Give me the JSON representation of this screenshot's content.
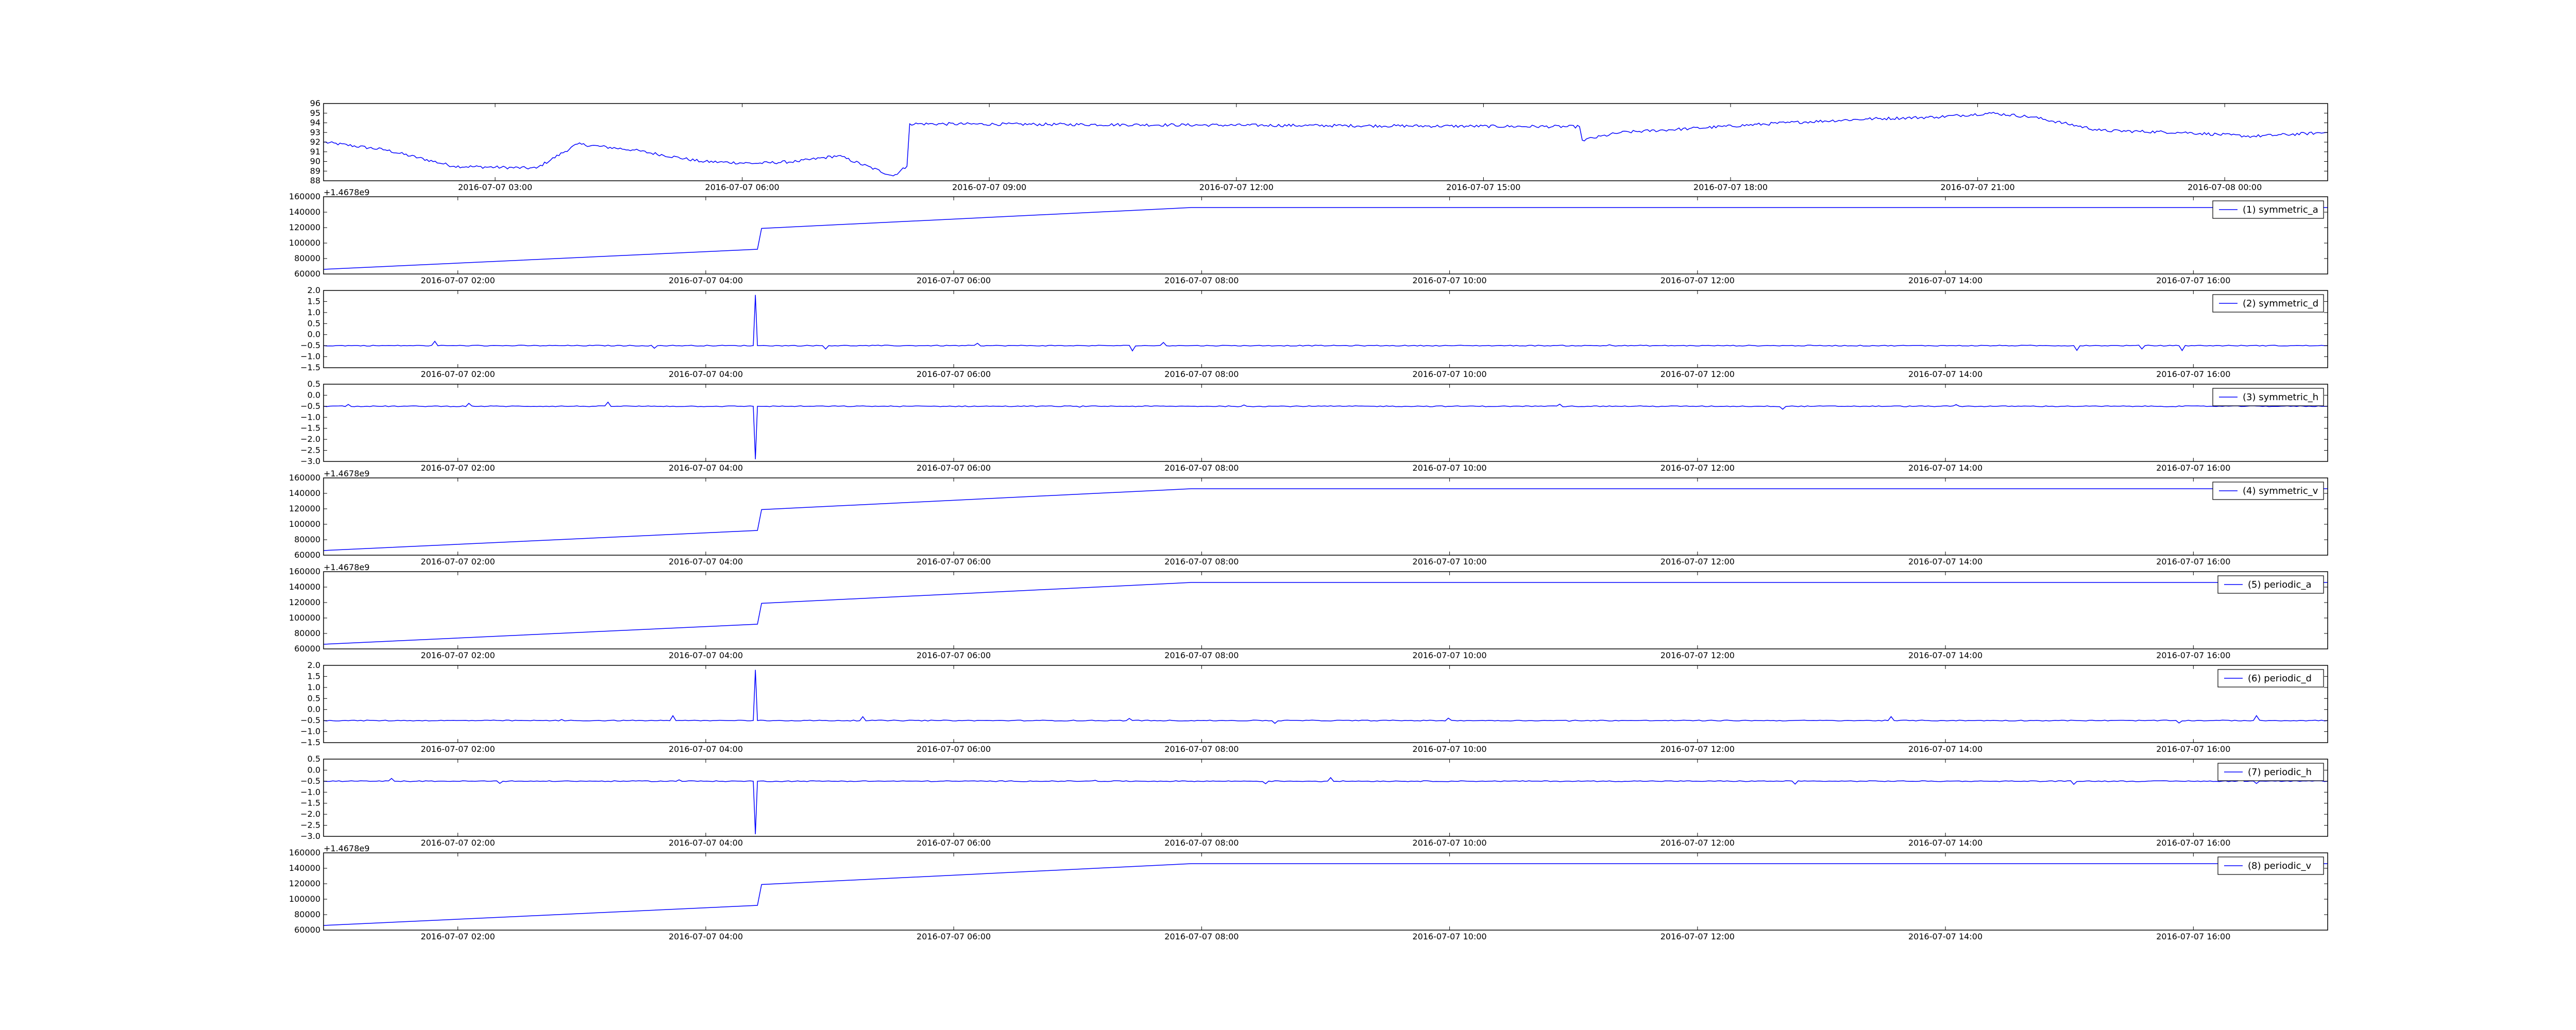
{
  "figure": {
    "background": "#ffffff",
    "line_color": "#0000ff"
  },
  "chart_data": [
    {
      "type": "line",
      "panel": 0,
      "ylim": [
        88,
        96
      ],
      "yticks": [
        88,
        89,
        90,
        91,
        92,
        93,
        94,
        95,
        96
      ],
      "ytick_labels": [
        "88",
        "89",
        "90",
        "91",
        "92",
        "93",
        "94",
        "95",
        "96"
      ],
      "xlim": [
        "2016-07-07 00:55",
        "2016-07-08 01:15"
      ],
      "xticks": [
        "2016-07-07 03:00",
        "2016-07-07 06:00",
        "2016-07-07 09:00",
        "2016-07-07 12:00",
        "2016-07-07 15:00",
        "2016-07-07 18:00",
        "2016-07-07 21:00",
        "2016-07-08 00:00"
      ],
      "xtick_labels": [
        "2016-07-07 03:00",
        "2016-07-07 06:00",
        "2016-07-07 09:00",
        "2016-07-07 12:00",
        "2016-07-07 15:00",
        "2016-07-07 18:00",
        "2016-07-07 21:00",
        "2016-07-08 00:00"
      ],
      "offset_label": "",
      "legend": null,
      "legend_position": "",
      "noise": 0.3,
      "x": [
        "2016-07-07 00:55",
        "2016-07-07 01:40",
        "2016-07-07 02:30",
        "2016-07-07 03:30",
        "2016-07-07 04:00",
        "2016-07-07 04:40",
        "2016-07-07 05:30",
        "2016-07-07 06:10",
        "2016-07-07 06:40",
        "2016-07-07 07:10",
        "2016-07-07 07:50",
        "2016-07-07 08:00",
        "2016-07-07 08:02",
        "2016-07-07 16:10",
        "2016-07-07 16:12",
        "2016-07-07 16:40",
        "2016-07-07 17:30",
        "2016-07-07 18:40",
        "2016-07-07 19:40",
        "2016-07-07 20:30",
        "2016-07-07 21:10",
        "2016-07-07 21:40",
        "2016-07-07 22:30",
        "2016-07-07 23:30",
        "2016-07-08 00:20",
        "2016-07-08 01:15"
      ],
      "y": [
        92.0,
        91.2,
        89.5,
        89.3,
        91.8,
        91.2,
        90.0,
        89.8,
        90.0,
        90.6,
        88.5,
        89.5,
        93.9,
        93.6,
        92.2,
        93.0,
        93.4,
        94.0,
        94.4,
        94.6,
        95.0,
        94.6,
        93.2,
        93.0,
        92.6,
        93.0
      ]
    },
    {
      "type": "line",
      "panel": 1,
      "ylim": [
        60000,
        160000
      ],
      "yticks": [
        60000,
        80000,
        100000,
        120000,
        140000,
        160000
      ],
      "ytick_labels": [
        "60000",
        "80000",
        "100000",
        "120000",
        "140000",
        "160000"
      ],
      "xlim": [
        "2016-07-07 00:55",
        "2016-07-07 17:05"
      ],
      "xticks": [
        "2016-07-07 02:00",
        "2016-07-07 04:00",
        "2016-07-07 06:00",
        "2016-07-07 08:00",
        "2016-07-07 10:00",
        "2016-07-07 12:00",
        "2016-07-07 14:00",
        "2016-07-07 16:00"
      ],
      "xtick_labels": [
        "2016-07-07 02:00",
        "2016-07-07 04:00",
        "2016-07-07 06:00",
        "2016-07-07 08:00",
        "2016-07-07 10:00",
        "2016-07-07 12:00",
        "2016-07-07 14:00",
        "2016-07-07 16:00"
      ],
      "offset_label": "+1.4678e9",
      "legend": "(1) symmetric_a",
      "legend_position": "top-right",
      "noise": 0,
      "x": [
        "2016-07-07 00:55",
        "2016-07-07 04:25",
        "2016-07-07 04:27",
        "2016-07-07 07:55",
        "2016-07-07 17:05"
      ],
      "y": [
        66000,
        92000,
        119000,
        146000,
        146000
      ]
    },
    {
      "type": "line",
      "panel": 2,
      "ylim": [
        -1.5,
        2.0
      ],
      "yticks": [
        -1.5,
        -1.0,
        -0.5,
        0.0,
        0.5,
        1.0,
        1.5,
        2.0
      ],
      "ytick_labels": [
        "−1.5",
        "−1.0",
        "−0.5",
        "0.0",
        "0.5",
        "1.0",
        "1.5",
        "2.0"
      ],
      "xlim": [
        "2016-07-07 00:55",
        "2016-07-07 17:05"
      ],
      "xticks": [
        "2016-07-07 02:00",
        "2016-07-07 04:00",
        "2016-07-07 06:00",
        "2016-07-07 08:00",
        "2016-07-07 10:00",
        "2016-07-07 12:00",
        "2016-07-07 14:00",
        "2016-07-07 16:00"
      ],
      "xtick_labels": [
        "2016-07-07 02:00",
        "2016-07-07 04:00",
        "2016-07-07 06:00",
        "2016-07-07 08:00",
        "2016-07-07 10:00",
        "2016-07-07 12:00",
        "2016-07-07 14:00",
        "2016-07-07 16:00"
      ],
      "offset_label": "",
      "legend": "(2) symmetric_d",
      "legend_position": "top-right",
      "noise": 0.04,
      "x": [
        "2016-07-07 00:55",
        "2016-07-07 04:23",
        "2016-07-07 04:24",
        "2016-07-07 04:25",
        "2016-07-07 07:55",
        "2016-07-07 17:05"
      ],
      "y": [
        -0.5,
        -0.5,
        1.8,
        -0.5,
        -0.5,
        -0.5
      ]
    },
    {
      "type": "line",
      "panel": 3,
      "ylim": [
        -3.0,
        0.5
      ],
      "yticks": [
        -3.0,
        -2.5,
        -2.0,
        -1.5,
        -1.0,
        -0.5,
        0.0,
        0.5
      ],
      "ytick_labels": [
        "−3.0",
        "−2.5",
        "−2.0",
        "−1.5",
        "−1.0",
        "−0.5",
        "0.0",
        "0.5"
      ],
      "xlim": [
        "2016-07-07 00:55",
        "2016-07-07 17:05"
      ],
      "xticks": [
        "2016-07-07 02:00",
        "2016-07-07 04:00",
        "2016-07-07 06:00",
        "2016-07-07 08:00",
        "2016-07-07 10:00",
        "2016-07-07 12:00",
        "2016-07-07 14:00",
        "2016-07-07 16:00"
      ],
      "xtick_labels": [
        "2016-07-07 02:00",
        "2016-07-07 04:00",
        "2016-07-07 06:00",
        "2016-07-07 08:00",
        "2016-07-07 10:00",
        "2016-07-07 12:00",
        "2016-07-07 14:00",
        "2016-07-07 16:00"
      ],
      "offset_label": "",
      "legend": "(3) symmetric_h",
      "legend_position": "top-right",
      "noise": 0.04,
      "x": [
        "2016-07-07 00:55",
        "2016-07-07 04:23",
        "2016-07-07 04:24",
        "2016-07-07 04:25",
        "2016-07-07 07:55",
        "2016-07-07 17:05"
      ],
      "y": [
        -0.5,
        -0.5,
        -2.9,
        -0.5,
        -0.5,
        -0.5
      ]
    },
    {
      "type": "line",
      "panel": 4,
      "ylim": [
        60000,
        160000
      ],
      "yticks": [
        60000,
        80000,
        100000,
        120000,
        140000,
        160000
      ],
      "ytick_labels": [
        "60000",
        "80000",
        "100000",
        "120000",
        "140000",
        "160000"
      ],
      "xlim": [
        "2016-07-07 00:55",
        "2016-07-07 17:05"
      ],
      "xticks": [
        "2016-07-07 02:00",
        "2016-07-07 04:00",
        "2016-07-07 06:00",
        "2016-07-07 08:00",
        "2016-07-07 10:00",
        "2016-07-07 12:00",
        "2016-07-07 14:00",
        "2016-07-07 16:00"
      ],
      "xtick_labels": [
        "2016-07-07 02:00",
        "2016-07-07 04:00",
        "2016-07-07 06:00",
        "2016-07-07 08:00",
        "2016-07-07 10:00",
        "2016-07-07 12:00",
        "2016-07-07 14:00",
        "2016-07-07 16:00"
      ],
      "offset_label": "+1.4678e9",
      "legend": "(4) symmetric_v",
      "legend_position": "top-right",
      "noise": 0,
      "x": [
        "2016-07-07 00:55",
        "2016-07-07 04:25",
        "2016-07-07 04:27",
        "2016-07-07 07:55",
        "2016-07-07 17:05"
      ],
      "y": [
        66000,
        92000,
        119000,
        146000,
        146000
      ]
    },
    {
      "type": "line",
      "panel": 5,
      "ylim": [
        60000,
        160000
      ],
      "yticks": [
        60000,
        80000,
        100000,
        120000,
        140000,
        160000
      ],
      "ytick_labels": [
        "60000",
        "80000",
        "100000",
        "120000",
        "140000",
        "160000"
      ],
      "xlim": [
        "2016-07-07 00:55",
        "2016-07-07 17:05"
      ],
      "xticks": [
        "2016-07-07 02:00",
        "2016-07-07 04:00",
        "2016-07-07 06:00",
        "2016-07-07 08:00",
        "2016-07-07 10:00",
        "2016-07-07 12:00",
        "2016-07-07 14:00",
        "2016-07-07 16:00"
      ],
      "xtick_labels": [
        "2016-07-07 02:00",
        "2016-07-07 04:00",
        "2016-07-07 06:00",
        "2016-07-07 08:00",
        "2016-07-07 10:00",
        "2016-07-07 12:00",
        "2016-07-07 14:00",
        "2016-07-07 16:00"
      ],
      "offset_label": "+1.4678e9",
      "legend": "(5) periodic_a",
      "legend_position": "top-right",
      "noise": 0,
      "x": [
        "2016-07-07 00:55",
        "2016-07-07 04:25",
        "2016-07-07 04:27",
        "2016-07-07 07:55",
        "2016-07-07 17:05"
      ],
      "y": [
        66000,
        92000,
        119000,
        146000,
        146000
      ]
    },
    {
      "type": "line",
      "panel": 6,
      "ylim": [
        -1.5,
        2.0
      ],
      "yticks": [
        -1.5,
        -1.0,
        -0.5,
        0.0,
        0.5,
        1.0,
        1.5,
        2.0
      ],
      "ytick_labels": [
        "−1.5",
        "−1.0",
        "−0.5",
        "0.0",
        "0.5",
        "1.0",
        "1.5",
        "2.0"
      ],
      "xlim": [
        "2016-07-07 00:55",
        "2016-07-07 17:05"
      ],
      "xticks": [
        "2016-07-07 02:00",
        "2016-07-07 04:00",
        "2016-07-07 06:00",
        "2016-07-07 08:00",
        "2016-07-07 10:00",
        "2016-07-07 12:00",
        "2016-07-07 14:00",
        "2016-07-07 16:00"
      ],
      "xtick_labels": [
        "2016-07-07 02:00",
        "2016-07-07 04:00",
        "2016-07-07 06:00",
        "2016-07-07 08:00",
        "2016-07-07 10:00",
        "2016-07-07 12:00",
        "2016-07-07 14:00",
        "2016-07-07 16:00"
      ],
      "offset_label": "",
      "legend": "(6) periodic_d",
      "legend_position": "top-right",
      "noise": 0.04,
      "x": [
        "2016-07-07 00:55",
        "2016-07-07 04:23",
        "2016-07-07 04:24",
        "2016-07-07 04:25",
        "2016-07-07 07:55",
        "2016-07-07 17:05"
      ],
      "y": [
        -0.5,
        -0.5,
        1.8,
        -0.5,
        -0.5,
        -0.5
      ]
    },
    {
      "type": "line",
      "panel": 7,
      "ylim": [
        -3.0,
        0.5
      ],
      "yticks": [
        -3.0,
        -2.5,
        -2.0,
        -1.5,
        -1.0,
        -0.5,
        0.0,
        0.5
      ],
      "ytick_labels": [
        "−3.0",
        "−2.5",
        "−2.0",
        "−1.5",
        "−1.0",
        "−0.5",
        "0.0",
        "0.5"
      ],
      "xlim": [
        "2016-07-07 00:55",
        "2016-07-07 17:05"
      ],
      "xticks": [
        "2016-07-07 02:00",
        "2016-07-07 04:00",
        "2016-07-07 06:00",
        "2016-07-07 08:00",
        "2016-07-07 10:00",
        "2016-07-07 12:00",
        "2016-07-07 14:00",
        "2016-07-07 16:00"
      ],
      "xtick_labels": [
        "2016-07-07 02:00",
        "2016-07-07 04:00",
        "2016-07-07 06:00",
        "2016-07-07 08:00",
        "2016-07-07 10:00",
        "2016-07-07 12:00",
        "2016-07-07 14:00",
        "2016-07-07 16:00"
      ],
      "offset_label": "",
      "legend": "(7) periodic_h",
      "legend_position": "top-right",
      "noise": 0.04,
      "x": [
        "2016-07-07 00:55",
        "2016-07-07 04:23",
        "2016-07-07 04:24",
        "2016-07-07 04:25",
        "2016-07-07 07:55",
        "2016-07-07 17:05"
      ],
      "y": [
        -0.5,
        -0.5,
        -2.9,
        -0.5,
        -0.5,
        -0.5
      ]
    },
    {
      "type": "line",
      "panel": 8,
      "ylim": [
        60000,
        160000
      ],
      "yticks": [
        60000,
        80000,
        100000,
        120000,
        140000,
        160000
      ],
      "ytick_labels": [
        "60000",
        "80000",
        "100000",
        "120000",
        "140000",
        "160000"
      ],
      "xlim": [
        "2016-07-07 00:55",
        "2016-07-07 17:05"
      ],
      "xticks": [
        "2016-07-07 02:00",
        "2016-07-07 04:00",
        "2016-07-07 06:00",
        "2016-07-07 08:00",
        "2016-07-07 10:00",
        "2016-07-07 12:00",
        "2016-07-07 14:00",
        "2016-07-07 16:00"
      ],
      "xtick_labels": [
        "2016-07-07 02:00",
        "2016-07-07 04:00",
        "2016-07-07 06:00",
        "2016-07-07 08:00",
        "2016-07-07 10:00",
        "2016-07-07 12:00",
        "2016-07-07 14:00",
        "2016-07-07 16:00"
      ],
      "offset_label": "+1.4678e9",
      "legend": "(8) periodic_v",
      "legend_position": "top-right",
      "noise": 0,
      "x": [
        "2016-07-07 00:55",
        "2016-07-07 04:25",
        "2016-07-07 04:27",
        "2016-07-07 07:55",
        "2016-07-07 17:05"
      ],
      "y": [
        66000,
        92000,
        119000,
        146000,
        146000
      ]
    }
  ]
}
